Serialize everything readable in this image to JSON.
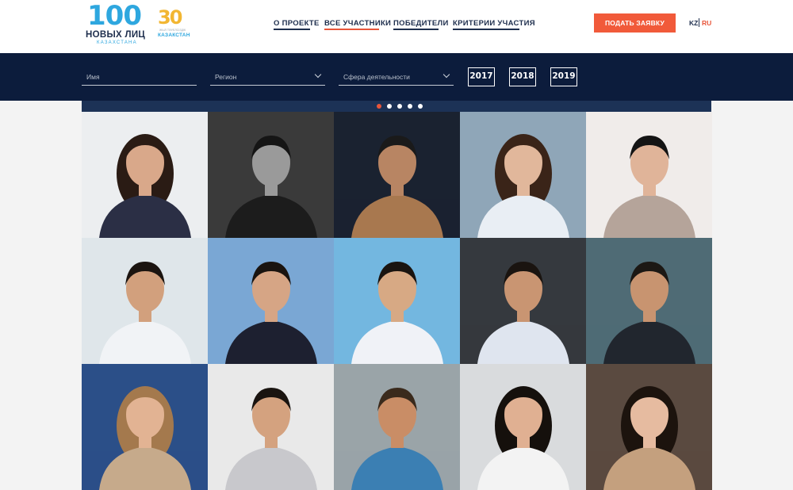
{
  "header": {
    "logo": {
      "number": "100",
      "title": "НОВЫХ ЛИЦ",
      "subtitle": "КАЗАХСТАНА"
    },
    "badge": {
      "number": "30",
      "tagline": "ЖЫЛ ТӘУЕЛСІЗДІК",
      "country": "КАЗАКСТАН"
    },
    "nav": [
      {
        "label": "О ПРОЕКТЕ",
        "active": false
      },
      {
        "label": "ВСЕ УЧАСТНИКИ",
        "active": true
      },
      {
        "label": "ПОБЕДИТЕЛИ",
        "active": false
      },
      {
        "label": "КРИТЕРИИ УЧАСТИЯ",
        "active": false
      }
    ],
    "apply_label": "ПОДАТЬ ЗАЯВКУ",
    "lang": {
      "kz": "KZ",
      "ru": "RU",
      "active": "RU"
    }
  },
  "filters": {
    "name_placeholder": "Имя",
    "region_label": "Регион",
    "sphere_label": "Сфера деятельности",
    "years": [
      "2017",
      "2018",
      "2019"
    ]
  },
  "slider": {
    "dots": 5,
    "active_index": 0
  },
  "participants": [
    {
      "row": 0,
      "col": 0,
      "bg": "#eceef0",
      "skin": "#d9a88a",
      "hair": "#2a1b14",
      "cloth": "#2b2f45",
      "long_hair": true
    },
    {
      "row": 0,
      "col": 1,
      "bg": "#3a3a3a",
      "skin": "#9a9a9a",
      "hair": "#151515",
      "cloth": "#1c1c1c",
      "long_hair": false
    },
    {
      "row": 0,
      "col": 2,
      "bg": "#1a2230",
      "skin": "#b88563",
      "hair": "#1a1a1a",
      "cloth": "#a8784f",
      "long_hair": false
    },
    {
      "row": 0,
      "col": 3,
      "bg": "#8fa6b8",
      "skin": "#e1b79b",
      "hair": "#3a2418",
      "cloth": "#e9eef4",
      "long_hair": true
    },
    {
      "row": 0,
      "col": 4,
      "bg": "#f0ecea",
      "skin": "#e0b499",
      "hair": "#141414",
      "cloth": "#b5a49a",
      "long_hair": false
    },
    {
      "row": 1,
      "col": 0,
      "bg": "#dfe6ea",
      "skin": "#d2a07d",
      "hair": "#1b1410",
      "cloth": "#f1f3f6",
      "long_hair": false
    },
    {
      "row": 1,
      "col": 1,
      "bg": "#7aa7d4",
      "skin": "#d6a585",
      "hair": "#1a1410",
      "cloth": "#1d2030",
      "long_hair": false
    },
    {
      "row": 1,
      "col": 2,
      "bg": "#73b7e0",
      "skin": "#d7a984",
      "hair": "#1a1410",
      "cloth": "#f0f2f7",
      "long_hair": false
    },
    {
      "row": 1,
      "col": 3,
      "bg": "#35393e",
      "skin": "#c99572",
      "hair": "#1a1410",
      "cloth": "#dfe5ef",
      "long_hair": false
    },
    {
      "row": 1,
      "col": 4,
      "bg": "#4f6b75",
      "skin": "#c89470",
      "hair": "#1c1814",
      "cloth": "#21262e",
      "long_hair": false
    },
    {
      "row": 2,
      "col": 0,
      "bg": "#2b4f88",
      "skin": "#e2b393",
      "hair": "#a4794d",
      "cloth": "#c6aa8b",
      "long_hair": true
    },
    {
      "row": 2,
      "col": 1,
      "bg": "#e9e9e9",
      "skin": "#d4a27f",
      "hair": "#1a1410",
      "cloth": "#c8c8cc",
      "long_hair": false
    },
    {
      "row": 2,
      "col": 2,
      "bg": "#9aa4a8",
      "skin": "#c98d66",
      "hair": "#3a2a1c",
      "cloth": "#3b7fb3",
      "long_hair": false
    },
    {
      "row": 2,
      "col": 3,
      "bg": "#d9dbdd",
      "skin": "#e0b092",
      "hair": "#15100c",
      "cloth": "#f3f3f3",
      "long_hair": true
    },
    {
      "row": 2,
      "col": 4,
      "bg": "#5a4a40",
      "skin": "#e6bba0",
      "hair": "#1c130d",
      "cloth": "#c4a07e",
      "long_hair": true
    }
  ]
}
